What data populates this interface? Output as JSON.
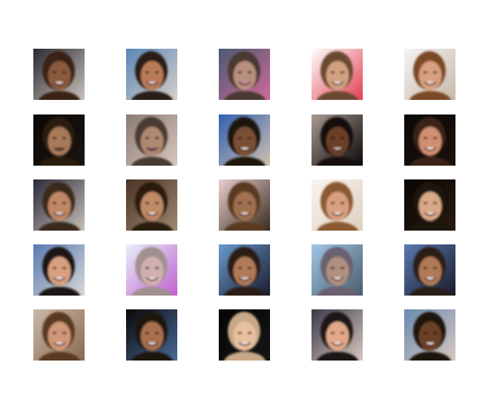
{
  "figure": {
    "rows": 5,
    "cols": 5,
    "tiles": [
      {
        "bg": "#2c2a30",
        "bg2": "#c9c2bc",
        "skin": "#8a5a3c",
        "hair": "#3a2418",
        "accent": "#ffffff"
      },
      {
        "bg": "#5a86b8",
        "bg2": "#d8d0c8",
        "skin": "#b87a58",
        "hair": "#2a1e16",
        "accent": "#f0f0f0"
      },
      {
        "bg": "#4a5a70",
        "bg2": "#d06a9a",
        "skin": "#b89080",
        "hair": "#4a3a30",
        "accent": "#e0a0c0"
      },
      {
        "bg": "#ffffff",
        "bg2": "#e04050",
        "skin": "#d0a080",
        "hair": "#6a4a30",
        "accent": "#ffffff"
      },
      {
        "bg": "#f4f4f4",
        "bg2": "#c8b8a8",
        "skin": "#d8a080",
        "hair": "#7a4a28",
        "accent": "#ffffff"
      },
      {
        "bg": "#0a0806",
        "bg2": "#1a1410",
        "skin": "#a87a5a",
        "hair": "#2a1a10",
        "accent": "#3a2a20"
      },
      {
        "bg": "#8a7a70",
        "bg2": "#d8c8c0",
        "skin": "#b08870",
        "hair": "#4a3a32",
        "accent": "#6a5a80"
      },
      {
        "bg": "#3060b0",
        "bg2": "#d0c0b0",
        "skin": "#7a5036",
        "hair": "#1a1210",
        "accent": "#ffffff"
      },
      {
        "bg": "#a89a90",
        "bg2": "#0a0808",
        "skin": "#6a4028",
        "hair": "#120c08",
        "accent": "#e8e0d8"
      },
      {
        "bg": "#0a0806",
        "bg2": "#1a120c",
        "skin": "#d09070",
        "hair": "#3a2418",
        "accent": "#ffffff"
      },
      {
        "bg": "#2a2a3a",
        "bg2": "#c8c0b8",
        "skin": "#c08866",
        "hair": "#3a2a1e",
        "accent": "#ffffff"
      },
      {
        "bg": "#4a3426",
        "bg2": "#a08870",
        "skin": "#c08a66",
        "hair": "#2a1a10",
        "accent": "#ffffff"
      },
      {
        "bg": "#e8d0d0",
        "bg2": "#3a2a20",
        "skin": "#a07050",
        "hair": "#5a3a22",
        "accent": "#ffffff"
      },
      {
        "bg": "#f8f4f0",
        "bg2": "#e0d0c0",
        "skin": "#d8a080",
        "hair": "#8a5a30",
        "accent": "#ffffff"
      },
      {
        "bg": "#0a0604",
        "bg2": "#2a1a10",
        "skin": "#d8a888",
        "hair": "#1e120a",
        "accent": "#ffffff"
      },
      {
        "bg": "#5a7ab0",
        "bg2": "#d8d8d8",
        "skin": "#d8a080",
        "hair": "#1a1412",
        "accent": "#ffffff"
      },
      {
        "bg": "#e8f0f8",
        "bg2": "#c060d0",
        "skin": "#d0b0b0",
        "hair": "#a09090",
        "accent": "#ffffff"
      },
      {
        "bg": "#6a9ad0",
        "bg2": "#1a1a2a",
        "skin": "#b07a58",
        "hair": "#2a1a14",
        "accent": "#ffffff"
      },
      {
        "bg": "#a0c8e8",
        "bg2": "#4a5a6a",
        "skin": "#b09080",
        "hair": "#6a6070",
        "accent": "#ffffff"
      },
      {
        "bg": "#5a7ab0",
        "bg2": "#1a1a2a",
        "skin": "#b07a58",
        "hair": "#2a1a14",
        "accent": "#ffffff"
      },
      {
        "bg": "#c8b8a8",
        "bg2": "#8a6a50",
        "skin": "#d09878",
        "hair": "#5a3a22",
        "accent": "#ffffff"
      },
      {
        "bg": "#0a0806",
        "bg2": "#4a6a9a",
        "skin": "#a87050",
        "hair": "#1a1410",
        "accent": "#ffffff"
      },
      {
        "bg": "#050505",
        "bg2": "#151515",
        "skin": "#e8c0a0",
        "hair": "#c8a888",
        "accent": "#ffffff"
      },
      {
        "bg": "#3a3a48",
        "bg2": "#d8c8c0",
        "skin": "#e0a888",
        "hair": "#1a1212",
        "accent": "#ffffff"
      },
      {
        "bg": "#6a8ab0",
        "bg2": "#d8c8c0",
        "skin": "#6a4028",
        "hair": "#1a120c",
        "accent": "#ffffff"
      }
    ]
  }
}
